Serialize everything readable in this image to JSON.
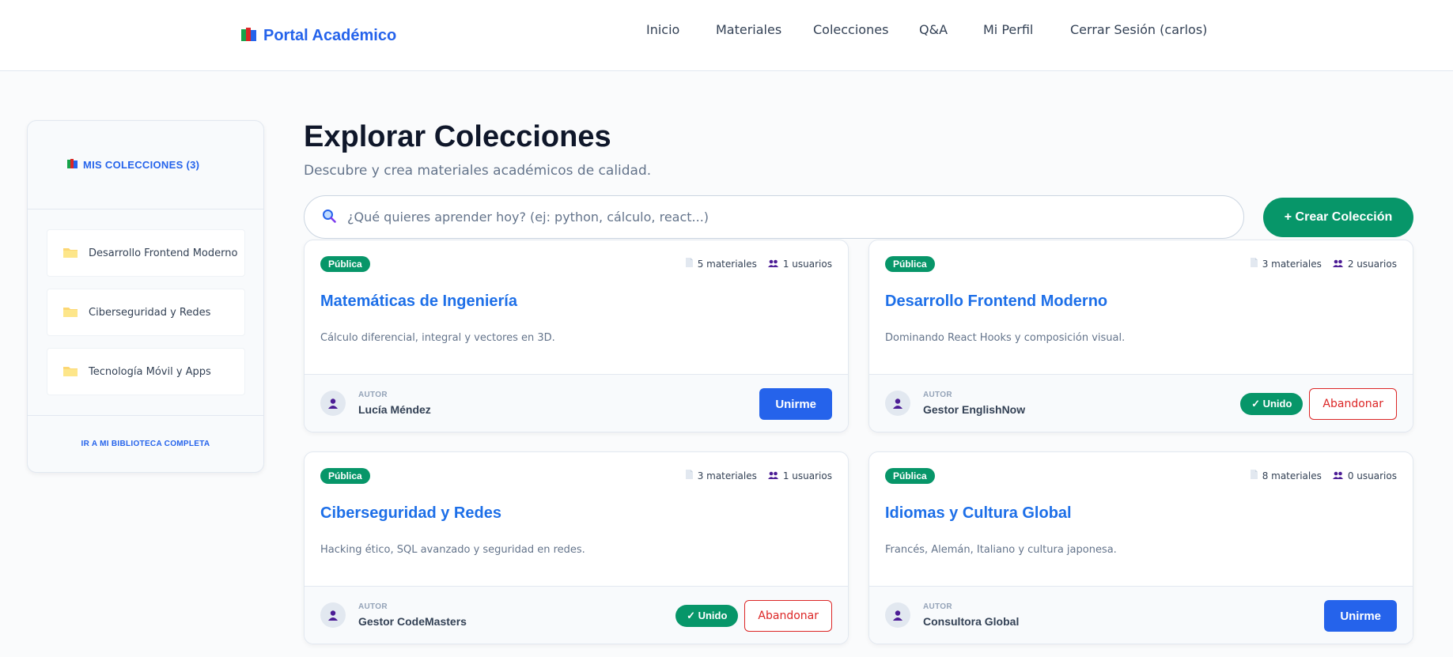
{
  "brand": {
    "name": "Portal Académico",
    "icon": "books-icon"
  },
  "nav": [
    {
      "label": "Inicio"
    },
    {
      "label": "Materiales"
    },
    {
      "label": "Colecciones"
    },
    {
      "label": "Q&A"
    },
    {
      "label": "Mi Perfil"
    },
    {
      "label": "Cerrar Sesión (carlos)"
    }
  ],
  "sidebar": {
    "title": "MIS COLECCIONES (3)",
    "items": [
      {
        "label": "Desarrollo Frontend Moderno",
        "icon": "folder-icon"
      },
      {
        "label": "Ciberseguridad y Redes",
        "icon": "folder-icon"
      },
      {
        "label": "Tecnología Móvil y Apps",
        "icon": "folder-icon"
      }
    ],
    "footer_link": "IR A MI BIBLIOTECA COMPLETA"
  },
  "main": {
    "title": "Explorar Colecciones",
    "subtitle": "Descubre y crea materiales académicos de calidad.",
    "search": {
      "placeholder": "¿Qué quieres aprender hoy? (ej: python, cálculo, react...)"
    },
    "create_button": "+ Crear Colección"
  },
  "card_labels": {
    "author_label": "AUTOR",
    "join": "Unirme",
    "joined": "✓ Unido",
    "leave": "Abandonar"
  },
  "cards": [
    {
      "badge": "Pública",
      "materials": "5 materiales",
      "users": "1 usuarios",
      "title": "Matemáticas de Ingeniería",
      "description": "Cálculo diferencial, integral y vectores en 3D.",
      "author": "Lucía Méndez",
      "joined": false
    },
    {
      "badge": "Pública",
      "materials": "3 materiales",
      "users": "2 usuarios",
      "title": "Desarrollo Frontend Moderno",
      "description": "Dominando React Hooks y composición visual.",
      "author": "Gestor EnglishNow",
      "joined": true
    },
    {
      "badge": "Pública",
      "materials": "3 materiales",
      "users": "1 usuarios",
      "title": "Ciberseguridad y Redes",
      "description": "Hacking ético, SQL avanzado y seguridad en redes.",
      "author": "Gestor CodeMasters",
      "joined": true
    },
    {
      "badge": "Pública",
      "materials": "8 materiales",
      "users": "0 usuarios",
      "title": "Idiomas y Cultura Global",
      "description": "Francés, Alemán, Italiano y cultura japonesa.",
      "author": "Consultora Global",
      "joined": false
    }
  ],
  "colors": {
    "primary": "#2563eb",
    "success": "#079669",
    "danger": "#dc2626"
  }
}
